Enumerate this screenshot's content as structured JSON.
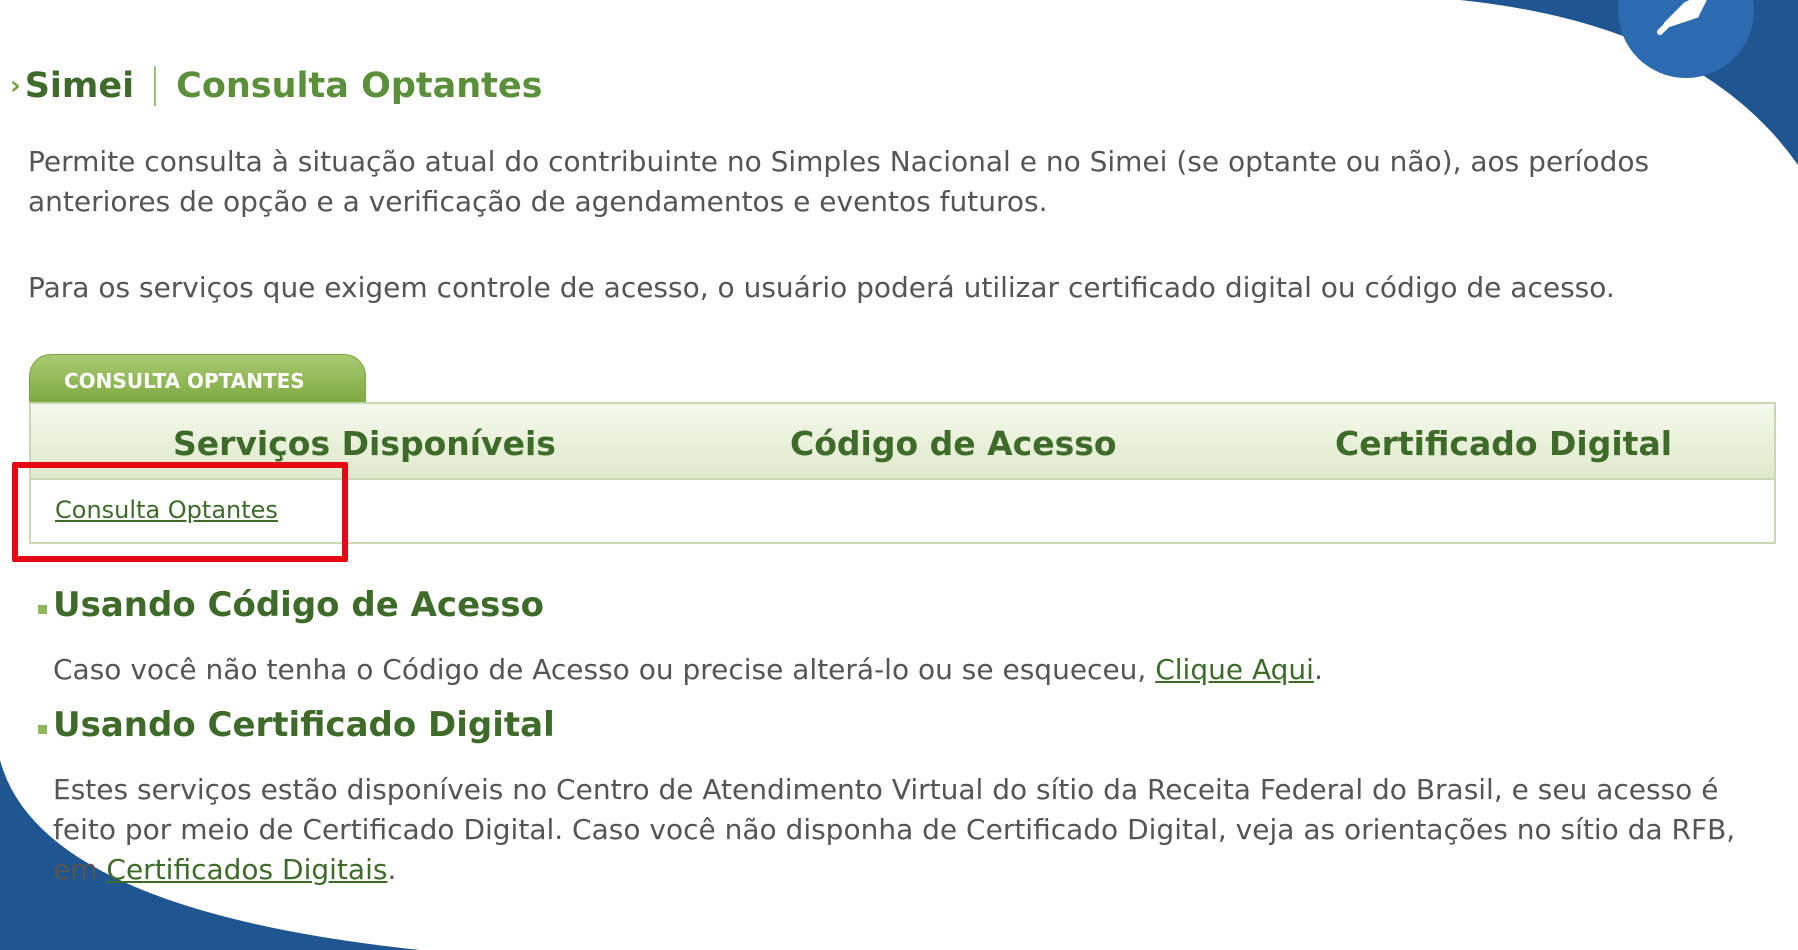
{
  "breadcrumb": {
    "section": "Simei",
    "page": "Consulta Optantes"
  },
  "intro": {
    "p1": "Permite consulta à situação atual do contribuinte no Simples Nacional e no Simei (se optante ou não), aos períodos anteriores de opção e a verificação de agendamentos e eventos futuros.",
    "p2": "Para os serviços que exigem controle de acesso, o usuário poderá utilizar certificado digital ou código de acesso."
  },
  "tab": {
    "label": "CONSULTA OPTANTES"
  },
  "table": {
    "headers": [
      "Serviços Disponíveis",
      "Código de Acesso",
      "Certificado Digital"
    ],
    "rows": [
      {
        "service": "Consulta Optantes"
      }
    ]
  },
  "section_codigo": {
    "title": "Usando Código de Acesso",
    "text": "Caso você não tenha o Código de Acesso ou precise alterá-lo ou se esqueceu, ",
    "link": "Clique Aqui",
    "end": "."
  },
  "section_cert": {
    "title": "Usando Certificado Digital",
    "text": "Estes serviços estão disponíveis no Centro de Atendimento Virtual do sítio da Receita Federal do Brasil, e seu acesso é feito por meio de Certificado Digital. Caso você não disponha de Certificado Digital, veja as orientações no sítio da RFB, em ",
    "link": "Certificados Digitais",
    "end": "."
  },
  "colors": {
    "accent_green": "#3e6b2a",
    "tab_green": "#7aa83e",
    "frame_blue": "#1f5591",
    "highlight_red": "#e50914"
  },
  "icons": {
    "breadcrumb": "chevron-right-icon",
    "section_bullet": "square-bullet-icon",
    "corner": "pin-icon"
  }
}
